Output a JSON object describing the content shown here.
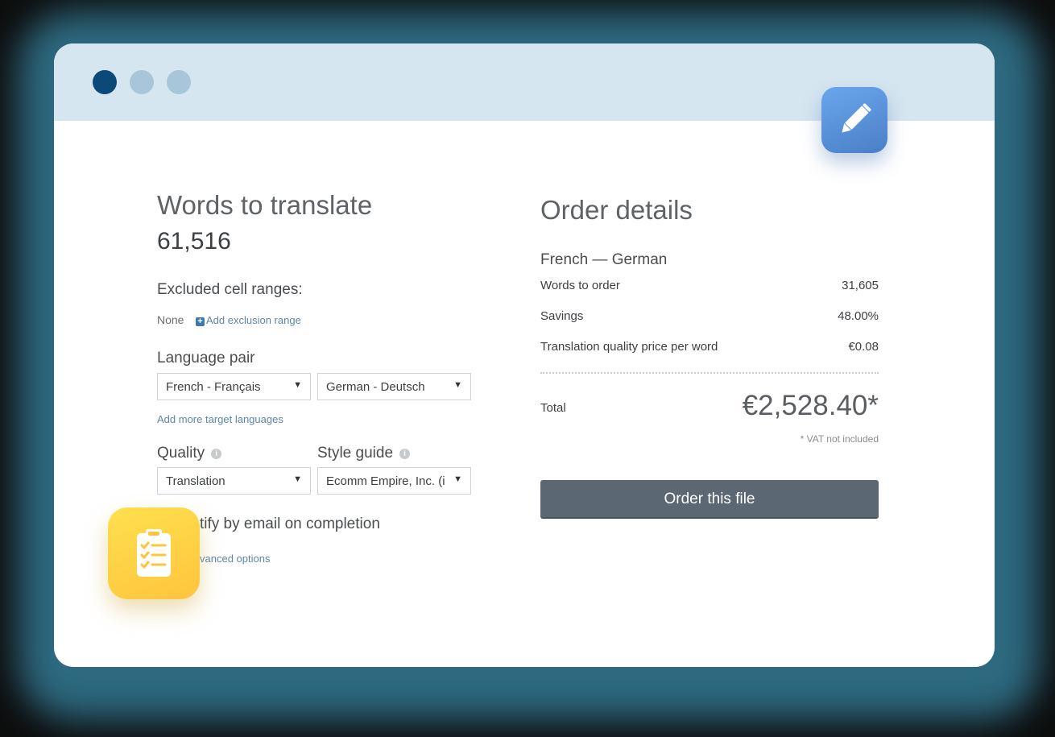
{
  "window": {
    "traffic_lights": [
      "dark-blue",
      "light-blue",
      "light-blue"
    ]
  },
  "left": {
    "title": "Words to translate",
    "word_count": "61,516",
    "excluded_label": "Excluded cell ranges:",
    "excluded_value": "None",
    "add_exclusion": "Add exclusion range",
    "language_pair_label": "Language pair",
    "source_language": "French - Français",
    "target_language": "German - Deutsch",
    "add_target_languages": "Add more target languages",
    "quality_label": "Quality",
    "quality_value": "Translation",
    "style_guide_label": "Style guide",
    "style_guide_value": "Ecomm Empire, Inc. (i",
    "notify_label": "tify by email on completion",
    "advanced_options": "vanced options"
  },
  "right": {
    "title": "Order details",
    "pair": "French — German",
    "rows": [
      {
        "label": "Words to order",
        "value": "31,605"
      },
      {
        "label": "Savings",
        "value": "48.00%"
      },
      {
        "label": "Translation quality price per word",
        "value": "€0.08"
      }
    ],
    "total_label": "Total",
    "total_value": "€2,528.40*",
    "vat_note": "* VAT not included",
    "order_button": "Order this file"
  },
  "icons": {
    "edit_app": "pencil-icon",
    "clipboard_app": "clipboard-checklist-icon"
  },
  "colors": {
    "titlebar": "#d5e6f0",
    "order_button": "#5b6874",
    "link": "#5d86a8",
    "edit_icon": "#5b93de",
    "clipboard_icon": "#ffd23f"
  }
}
